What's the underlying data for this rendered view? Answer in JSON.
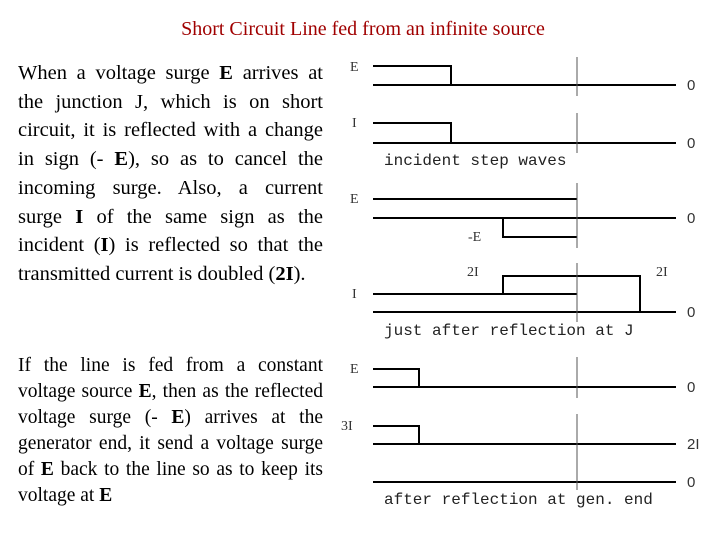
{
  "title": "Short Circuit Line fed from an infinite source",
  "paragraph1": [
    {
      "t": "When a voltage surge ",
      "b": false
    },
    {
      "t": "E",
      "b": true
    },
    {
      "t": " arrives at the junction J, which is on short circuit, it is reflected with a change in sign (- ",
      "b": false
    },
    {
      "t": "E",
      "b": true
    },
    {
      "t": "), so as to cancel the incoming surge. Also, a current surge ",
      "b": false
    },
    {
      "t": "I",
      "b": true
    },
    {
      "t": " of the same sign as the incident (",
      "b": false
    },
    {
      "t": "I",
      "b": true
    },
    {
      "t": ") is reflected so that the transmitted current is doubled (",
      "b": false
    },
    {
      "t": "2I",
      "b": true
    },
    {
      "t": ").",
      "b": false
    }
  ],
  "paragraph2": [
    {
      "t": "If the line is fed from a constant voltage source ",
      "b": false
    },
    {
      "t": "E",
      "b": true
    },
    {
      "t": ", then as the reflected voltage surge (- ",
      "b": false
    },
    {
      "t": "E",
      "b": true
    },
    {
      "t": ") arrives at the generator end, it send a voltage surge of ",
      "b": false
    },
    {
      "t": "E",
      "b": true
    },
    {
      "t": " back to the line so as to keep its voltage at ",
      "b": false
    },
    {
      "t": "E",
      "b": true
    }
  ],
  "diagram": {
    "incident": {
      "voltage_label": "E",
      "current_label": "I",
      "zero": "0",
      "caption": "incident step waves"
    },
    "reflection_j": {
      "voltage_label": "E",
      "neg_label": "-E",
      "current_label": "I",
      "double_left": "2I",
      "double_right": "2I",
      "zero": "0",
      "caption": "just after reflection at J"
    },
    "reflection_gen": {
      "voltage_label": "E",
      "current_label": "3I",
      "current_base": "2I",
      "zero": "0",
      "caption": "after reflection at gen. end"
    }
  }
}
